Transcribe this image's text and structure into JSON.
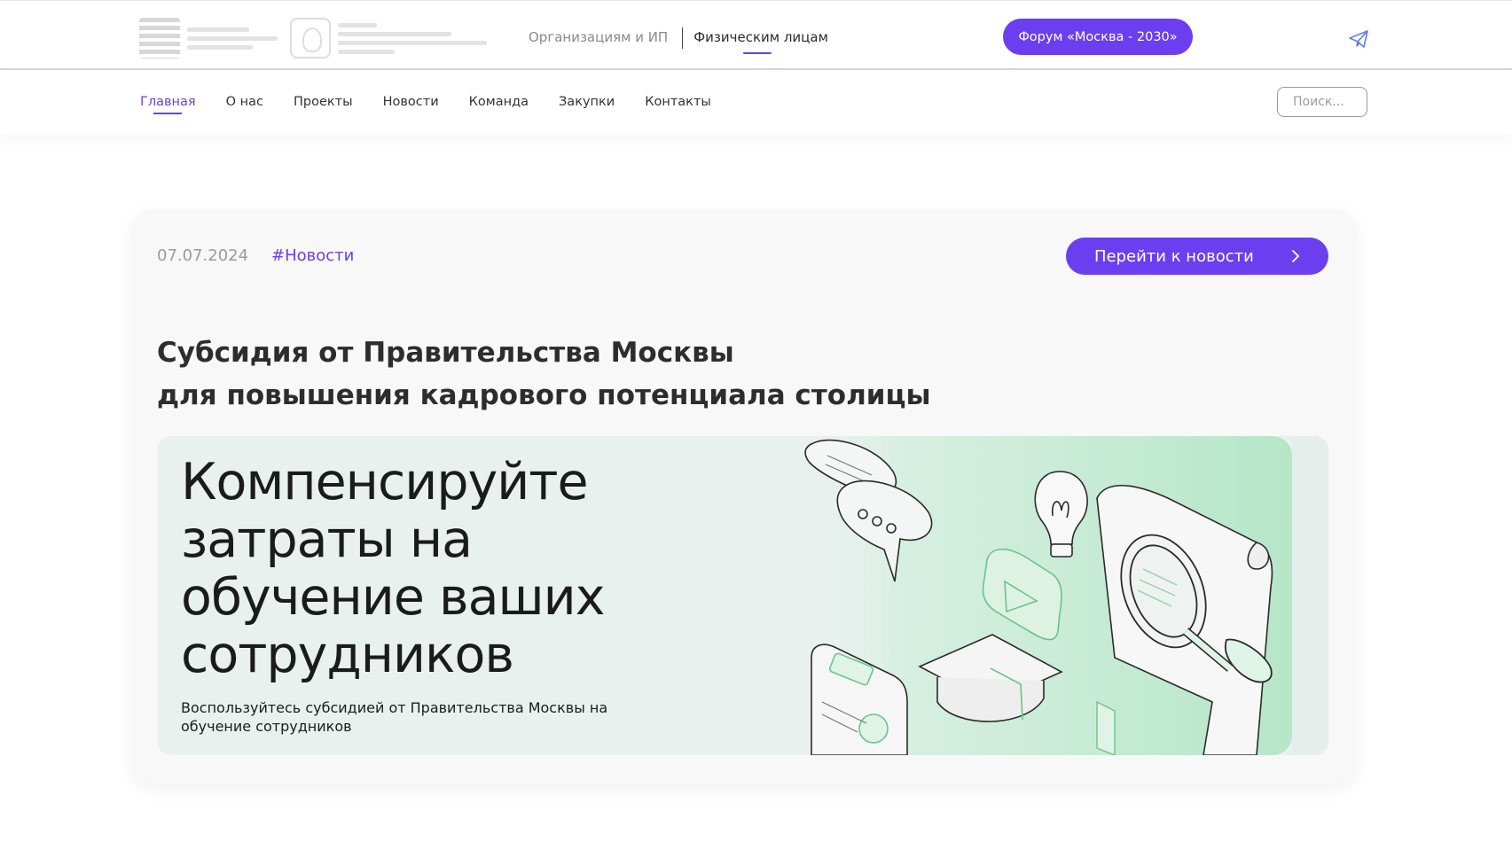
{
  "topbar": {
    "audience_tabs": [
      {
        "label": "Организациям и ИП",
        "active": false
      },
      {
        "label": "Физическим лицам",
        "active": true
      }
    ],
    "forum_button": "Форум «Москва - 2030»",
    "telegram_icon": "paper-plane-icon"
  },
  "nav": {
    "items": [
      {
        "label": "Главная",
        "active": true
      },
      {
        "label": "О нас",
        "active": false
      },
      {
        "label": "Проекты",
        "active": false
      },
      {
        "label": "Новости",
        "active": false
      },
      {
        "label": "Команда",
        "active": false
      },
      {
        "label": "Закупки",
        "active": false
      },
      {
        "label": "Контакты",
        "active": false
      }
    ],
    "search_placeholder": "Поиск..."
  },
  "news": {
    "date": "07.07.2024",
    "tag": "#Новости",
    "go_button": "Перейти к новости",
    "title_line1": "Субсидия от Правительства Москвы",
    "title_line2": "для повышения кадрового потенциала столицы",
    "banner": {
      "heading_line1": "Компенсируйте",
      "heading_line2": "затраты на",
      "heading_line3": "обучение ваших",
      "heading_line4": "сотрудников",
      "subtitle": "Воспользуйтесь субсидией от Правительства Москвы на обучение сотрудников"
    }
  },
  "colors": {
    "accent": "#6b3ff0",
    "banner_bg": "#e9f1ef",
    "banner_art_green": "#bfe8cf"
  }
}
